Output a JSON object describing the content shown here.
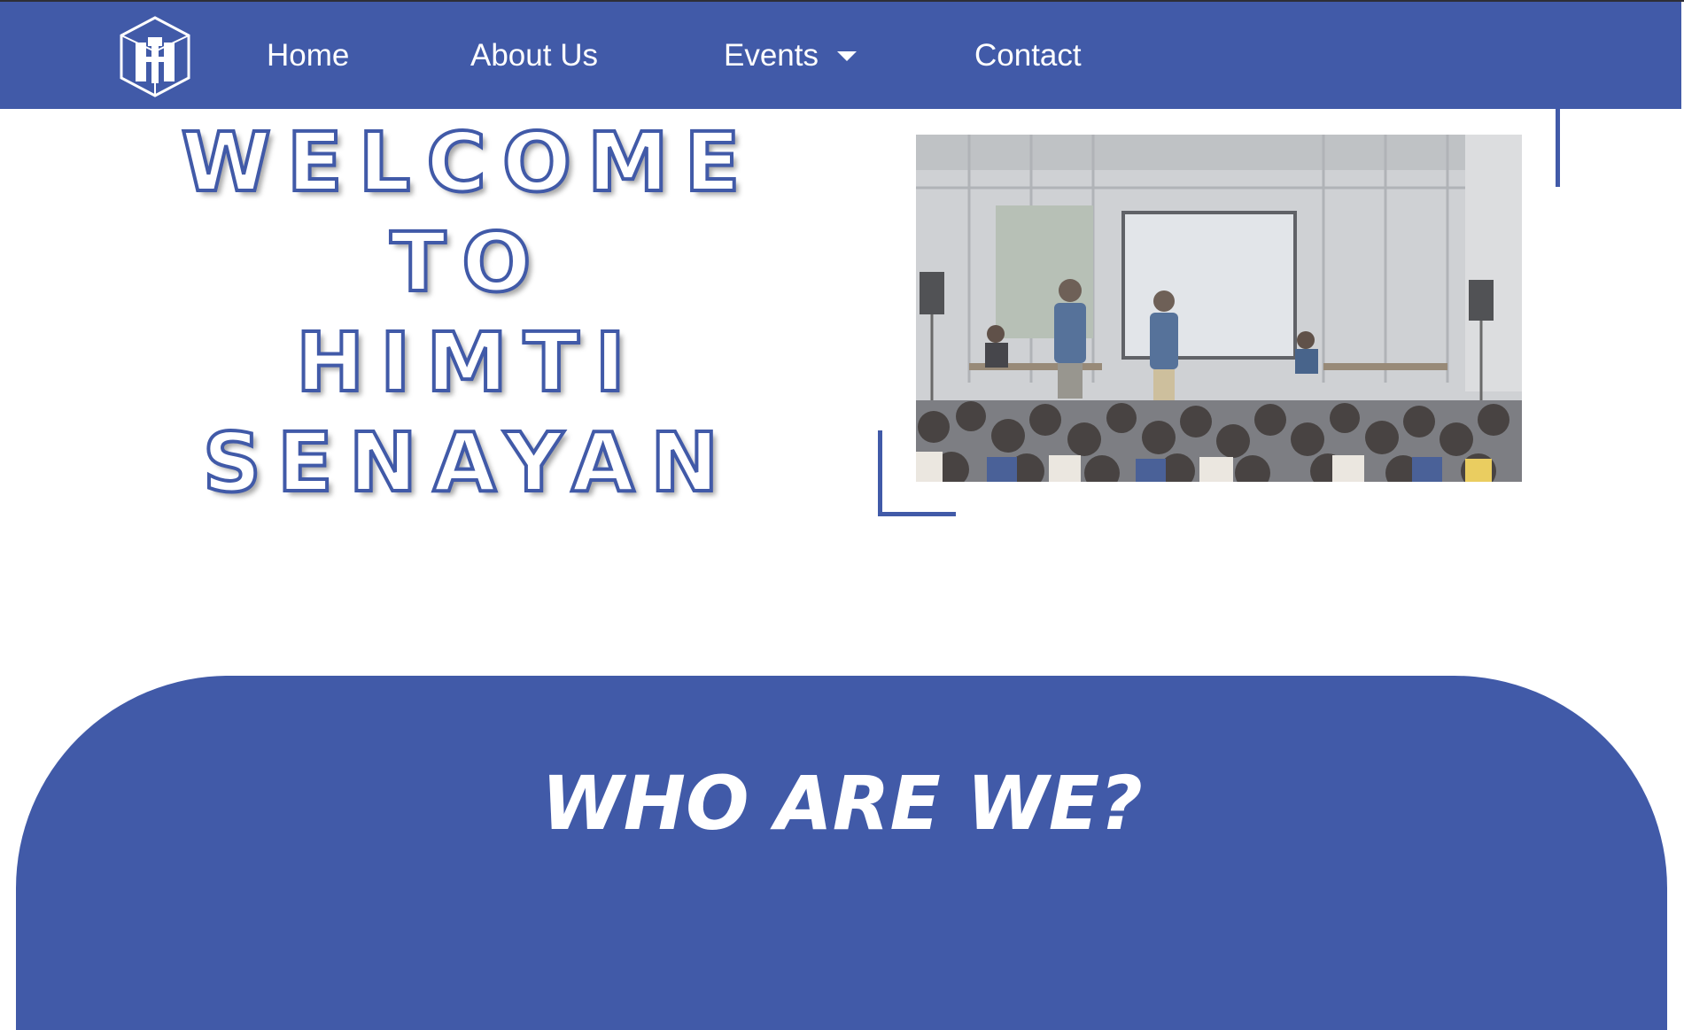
{
  "navbar": {
    "logo_icon": "himti-logo-icon",
    "items": [
      {
        "label": "Home"
      },
      {
        "label": "About Us"
      },
      {
        "label": "Events",
        "icon": "caret-down-icon"
      },
      {
        "label": "Contact"
      }
    ]
  },
  "hero": {
    "title_lines": [
      "WELCOME",
      "TO",
      "HIMTI",
      "SENAYAN"
    ],
    "photo_icon": "event-audience-photo"
  },
  "about": {
    "title": "WHO ARE WE?"
  },
  "colors": {
    "brand": "#415aa8",
    "background": "#ffffff",
    "text_light": "#ffffff"
  }
}
